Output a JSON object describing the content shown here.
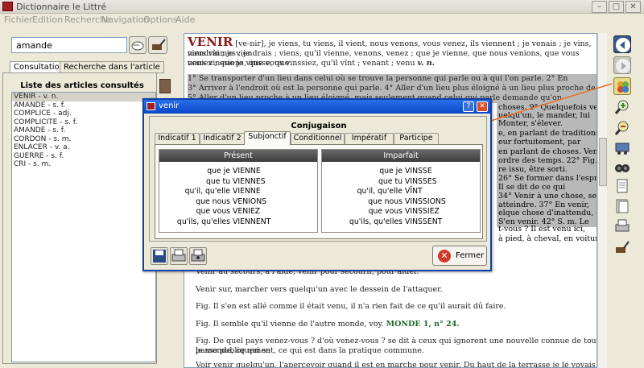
{
  "window": {
    "title": "Dictionnaire le Littré"
  },
  "menu": [
    "Fichier",
    "Edition",
    "Recherche",
    "Navigation",
    "Options",
    "Aide"
  ],
  "search": {
    "value": "amande"
  },
  "left_tabs": [
    "Consultation",
    "Recherche dans l'article"
  ],
  "list": {
    "title": "Liste des articles consultés",
    "items": [
      "VENIR - v. n.",
      "AMANDE - s. f.",
      "COMPLICE - adj.",
      "COMPLICITE - s. f.",
      "AMANDE - s. f.",
      "CORDON - s. m.",
      "ENLACER - v. a.",
      "GUERRE - s. f.",
      "CRI - s. m."
    ]
  },
  "article": {
    "head": "VENIR",
    "line1": "[ve-nir], je viens, tu viens, il vient, nous venons, vous venez, ils viennent ; je venais ; je vins, nous vînmes ; je",
    "line2": "viendrai ; je viendrais ; viens, qu'il vienne, venons, venez ; que je vienne, que nous venions, que vous veniez ; que je vinsse, que",
    "line3": "nous vinssions, que vous vinssiez, qu'il vînt ; venant ; venu",
    "line3b": "v. n.",
    "hl1": "1° Se transporter d'un lieu dans celui où se trouve la personne qui parle ou à qui l'on parle. 2° En termes de marine, venir à.",
    "hl2": "3° Arriver à l'endroit où est la personne qui parle. 4° Aller d'un lieu plus éloigné à un lieu plus proche de celui qui parle.",
    "hl3": "5° Aller d'un lieu proche à un lieu éloigné, mais seulement quand celui qui parle demande qu'on l'accompagne. 6° Aller et",
    "hl_right": [
      "choses. 9° Quelquefois venir,",
      "uelqu'un, le mander, lui",
      "Monter, s'élever.",
      "e, en parlant de traditions, de",
      "eur fortuitement, par",
      "en parlant de choses. Venir à",
      "ordre des temps. 22° Fig. Il se",
      "re issu, être sorti.",
      "26° Se former dans l'esprit,",
      "Il se dit de ce qui",
      "34° Venir à une chose, se",
      "atteindre. 37° En venir,",
      "elque chose d'inattendu, de",
      "S'en venir. 42° S. m. Le"
    ],
    "below_right": [
      "t-vous ? Il est venu ici,",
      "à pied, à cheval, en voiture."
    ],
    "p1": "Venir au secours, à l'aide, venir pour secourir, pour aider.",
    "p2": "Venir sur, marcher vers quelqu'un avec le dessein de l'attaquer.",
    "p3": "Fig. Il s'en est allé comme il était venu, il n'a rien fait de ce qu'il aurait dû faire.",
    "p4a": "Fig. Il semble qu'il vienne de l'autre monde, voy.",
    "p4b": "MONDE 1, n° 24.",
    "p5a": "Fig. De quel pays venez-vous ? d'où venez-vous ? se dit à ceux qui ignorent une nouvelle connue de tout le monde, ce qui se",
    "p5b": "passe publiquement, ce qui est dans la pratique commune.",
    "p6": "Voir venir quelqu'un, l'apercevoir quand il est en marche pour venir. Du haut de la terrasse je le voyais venir."
  },
  "dialog": {
    "title": "venir",
    "section": "Conjugaison",
    "tabs": [
      "Indicatif 1",
      "Indicatif 2",
      "Subjonctif",
      "Conditionnel",
      "Impératif",
      "Participe"
    ],
    "active_tab": "Subjonctif",
    "present": {
      "header": "Présent",
      "rows": [
        [
          "que je",
          "VIENNE"
        ],
        [
          "que tu",
          "VIENNES"
        ],
        [
          "qu'il, qu'elle",
          "VIENNE"
        ],
        [
          "que nous",
          "VENIONS"
        ],
        [
          "que vous",
          "VENIEZ"
        ],
        [
          "qu'ils, qu'elles",
          "VIENNENT"
        ]
      ]
    },
    "imparfait": {
      "header": "Imparfait",
      "rows": [
        [
          "que je",
          "VINSSE"
        ],
        [
          "que tu",
          "VINSSES"
        ],
        [
          "qu'il, qu'elle",
          "VÎNT"
        ],
        [
          "que nous",
          "VINSSIONS"
        ],
        [
          "que vous",
          "VINSSIEZ"
        ],
        [
          "qu'ils, qu'elles",
          "VINSSENT"
        ]
      ]
    },
    "close_label": "Fermer"
  },
  "colors": {
    "accent": "#0846c8",
    "annotation_arrow": "#e8702a",
    "link_green": "#1f6a2d"
  }
}
